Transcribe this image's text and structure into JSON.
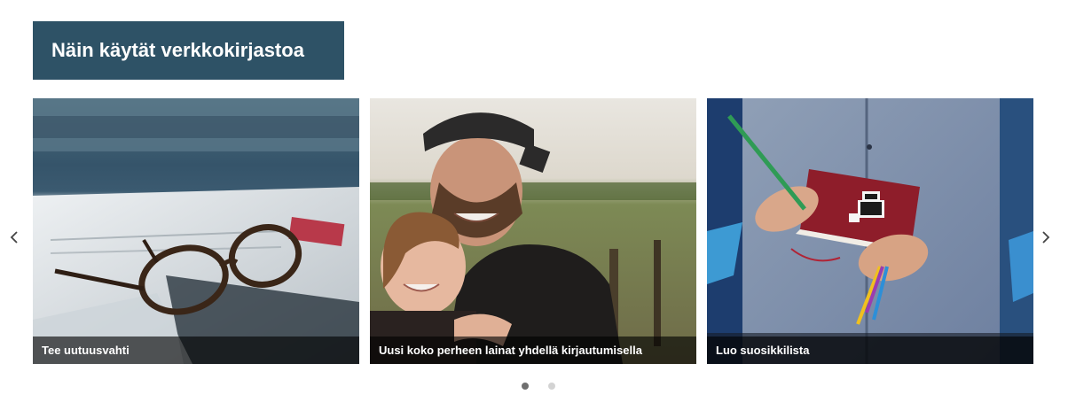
{
  "section": {
    "title": "Näin käytät verkkokirjastoa"
  },
  "carousel": {
    "prev_icon": "chevron-left-icon",
    "next_icon": "chevron-right-icon",
    "cards": [
      {
        "caption": "Tee uutuusvahti",
        "image": "glasses-on-newspaper"
      },
      {
        "caption": "Uusi koko perheen lainat yhdellä kirjautumisella",
        "image": "father-hugging-child"
      },
      {
        "caption": "Luo suosikkilista",
        "image": "person-writing-in-notebook"
      }
    ],
    "pagination": {
      "pages": 2,
      "active": 1
    }
  },
  "colors": {
    "heading_bg": "#2e5266",
    "caption_bg": "#000000",
    "dot_active": "#6f6f6f",
    "dot_inactive": "#d3d3d3"
  }
}
